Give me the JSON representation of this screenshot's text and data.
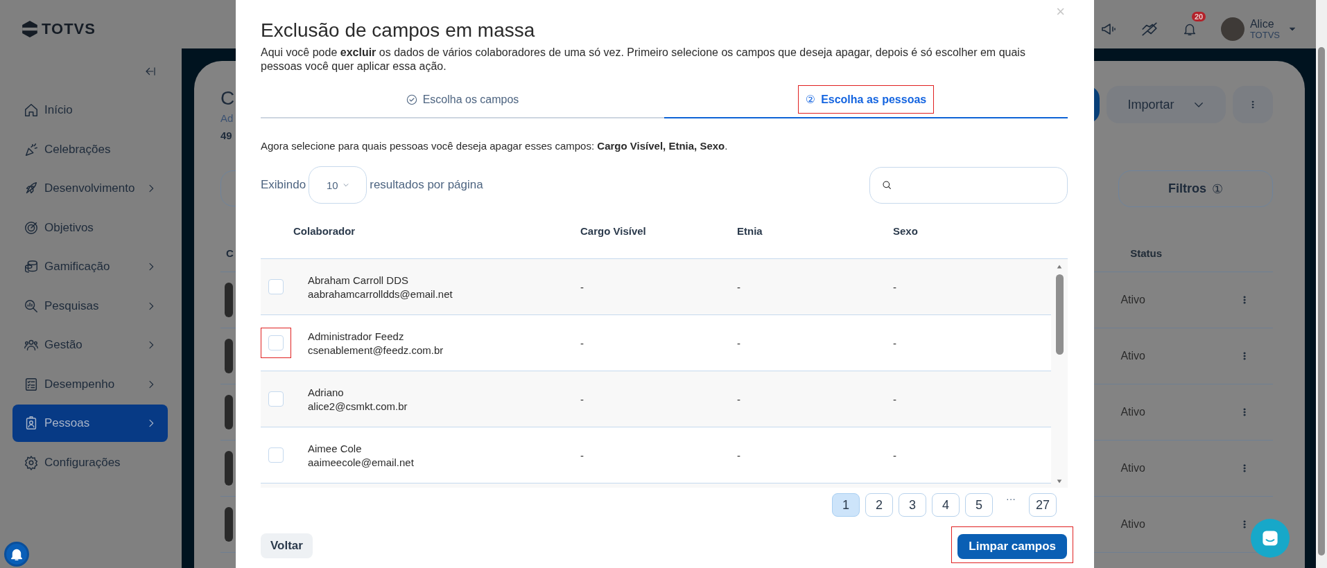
{
  "sidebar": {
    "logo": "TOTVS",
    "items": [
      {
        "label": "Início",
        "has_submenu": false,
        "selected": false
      },
      {
        "label": "Celebrações",
        "has_submenu": false,
        "selected": false
      },
      {
        "label": "Desenvolvimento",
        "has_submenu": true,
        "selected": false
      },
      {
        "label": "Objetivos",
        "has_submenu": false,
        "selected": false
      },
      {
        "label": "Gamificação",
        "has_submenu": true,
        "selected": false
      },
      {
        "label": "Pesquisas",
        "has_submenu": true,
        "selected": false
      },
      {
        "label": "Gestão",
        "has_submenu": true,
        "selected": false
      },
      {
        "label": "Desempenho",
        "has_submenu": true,
        "selected": false
      },
      {
        "label": "Pessoas",
        "has_submenu": true,
        "selected": true
      },
      {
        "label": "Configurações",
        "has_submenu": false,
        "selected": false
      }
    ]
  },
  "topbar": {
    "notification_count": "20",
    "user_name": "Alice",
    "user_org": "TOTVS"
  },
  "background_page": {
    "title": "C",
    "subtitle": "Ad",
    "count": "49",
    "import_button": "Importar",
    "filters_button": "Filtros",
    "filters_count": "①",
    "column_1": "C",
    "status_header": "Status",
    "rows": [
      {
        "status": "Ativo"
      },
      {
        "status": "Ativo"
      },
      {
        "status": "Ativo"
      },
      {
        "status": "Ativo"
      },
      {
        "status": "Ativo"
      }
    ]
  },
  "modal": {
    "close": "×",
    "title": "Exclusão de campos em massa",
    "description": "Aqui você pode **excluir** os dados de vários colaboradores de uma só vez. Primeiro selecione os campos que deseja apagar, depois é só escolher em quais pessoas você quer aplicar essa ação.",
    "tabs": [
      {
        "label": "Escolha os campos",
        "completed": true,
        "selected": false,
        "highlighted": false
      },
      {
        "label": "Escolha as pessoas",
        "marker": "②",
        "completed": false,
        "selected": true,
        "highlighted": true
      }
    ],
    "instruction": "Agora selecione para quais pessoas você deseja apagar esses campos: **Cargo Visível, Etnia, Sexo**.",
    "page_size": {
      "prefix": "Exibindo",
      "value": "10",
      "suffix": "resultados por página"
    },
    "table": {
      "columns": [
        "Colaborador",
        "Cargo Visível",
        "Etnia",
        "Sexo"
      ],
      "rows": [
        {
          "name": "Abraham Carroll DDS",
          "email": "aabrahamcarrolldds@email.net",
          "cargo": "-",
          "etnia": "-",
          "sexo": "-",
          "checked": false,
          "highlighted": false
        },
        {
          "name": "Administrador Feedz",
          "email": "csenablement@feedz.com.br",
          "cargo": "-",
          "etnia": "-",
          "sexo": "-",
          "checked": false,
          "highlighted": true
        },
        {
          "name": "Adriano",
          "email": "alice2@csmkt.com.br",
          "cargo": "-",
          "etnia": "-",
          "sexo": "-",
          "checked": false,
          "highlighted": false
        },
        {
          "name": "Aimee Cole",
          "email": "aaimeecole@email.net",
          "cargo": "-",
          "etnia": "-",
          "sexo": "-",
          "checked": false,
          "highlighted": false
        }
      ]
    },
    "pagination": {
      "pages": [
        {
          "label": "1",
          "selected": true
        },
        {
          "label": "2",
          "selected": false
        },
        {
          "label": "3",
          "selected": false
        },
        {
          "label": "4",
          "selected": false
        },
        {
          "label": "5",
          "selected": false
        }
      ],
      "ellipsis": "···",
      "last": "27"
    },
    "back_button": "Voltar",
    "primary_button": {
      "label": "Limpar campos",
      "highlighted": true
    }
  }
}
